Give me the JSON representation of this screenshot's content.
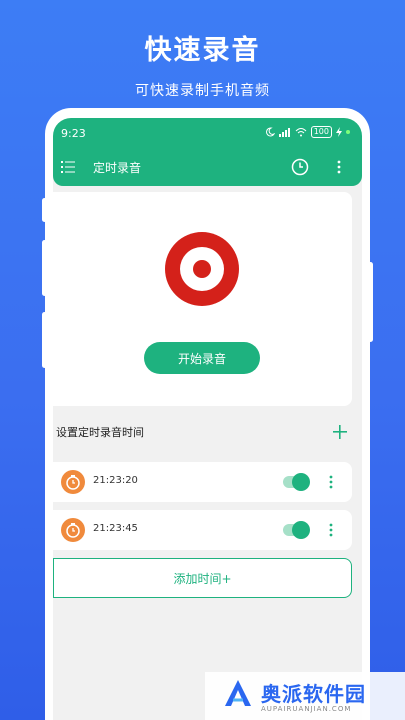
{
  "promo": {
    "headline": "快速录音",
    "subline": "可快速录制手机音频"
  },
  "status_bar": {
    "time": "9:23",
    "battery": "100"
  },
  "app_bar": {
    "title": "定时录音",
    "menu_icon": "menu-list-icon",
    "clock_icon": "clock-icon",
    "more_icon": "more-vertical-icon"
  },
  "recorder": {
    "icon": "record-icon",
    "start_label": "开始录音"
  },
  "schedule": {
    "section_title": "设置定时录音时间",
    "add_icon": "plus-icon",
    "timers": [
      {
        "time": "21:23:20",
        "enabled": true
      },
      {
        "time": "21:23:45",
        "enabled": true
      }
    ],
    "add_time_label": "添加时间+"
  },
  "watermark": {
    "text": "奥派软件园",
    "url": "AUPAIRUANJIAN.COM"
  },
  "colors": {
    "accent": "#1eb27f",
    "record_red": "#d4211a",
    "timer_orange": "#f08a3c",
    "background_blue": "#3b6ef0"
  }
}
